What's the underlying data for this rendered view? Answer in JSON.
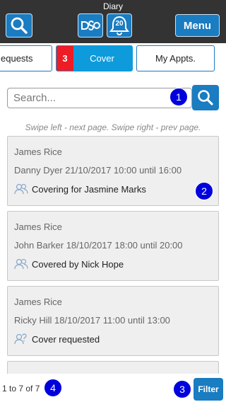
{
  "app": {
    "title": "Diary"
  },
  "header": {
    "search_icon": "search-icon",
    "logo_icon": "dso-logo-icon",
    "notification_count": "20",
    "menu_label": "Menu"
  },
  "tabs": [
    {
      "label": "equests"
    },
    {
      "label": "Cover",
      "badge": "3"
    },
    {
      "label": "My Appts."
    }
  ],
  "search": {
    "placeholder": "Search...",
    "value": ""
  },
  "hint": "Swipe left - next page. Swipe right - prev page.",
  "callouts": [
    "1",
    "2",
    "3",
    "4"
  ],
  "cards": [
    {
      "name": "James Rice",
      "detail": "Danny Dyer 21/10/2017 10:00 until 16:00",
      "status": "Covering for Jasmine Marks",
      "status_icon": "users-icon"
    },
    {
      "name": "James Rice",
      "detail": "John Barker 18/10/2017 18:00 until 20:00",
      "status": "Covered by Nick Hope",
      "status_icon": "user-icon"
    },
    {
      "name": "James Rice",
      "detail": "Ricky Hill 18/10/2017 11:00 until 13:00",
      "status": "Cover requested",
      "status_icon": "user-question-icon"
    }
  ],
  "footer": {
    "count": "1 to 7 of 7",
    "filter_label": "Filter"
  },
  "colors": {
    "accent": "#1a7cc1",
    "topbar": "#333333",
    "badge": "#ee1c25",
    "callout": "#0000dd",
    "active_tab": "#0e9bdc"
  }
}
